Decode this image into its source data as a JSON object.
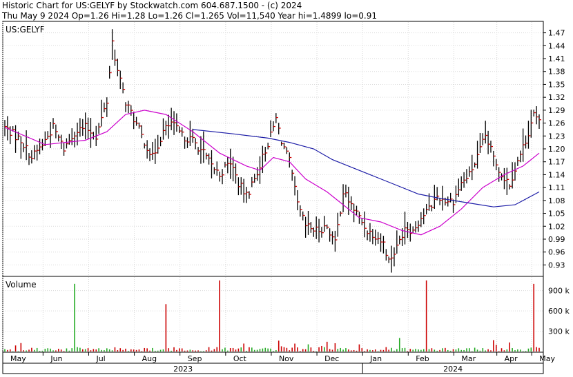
{
  "header": {
    "line1": "Historic Chart for US:GELYF by Stockwatch.com 604.687.1500 - (c) 2024",
    "line2": "Thu May  9 2024  Op=1.26  Hi=1.28  Lo=1.26  Cl=1.265  Vol=11,540  Year hi=1.4899  lo=0.91"
  },
  "colors": {
    "background": "#ffffff",
    "grid": "#d9d9d9",
    "up_bar": "#000000",
    "down_tick": "#cc0000",
    "ma_short": "#cc00cc",
    "ma_long": "#1a1aa6",
    "vol_up": "#22aa22",
    "vol_down": "#cc0000"
  },
  "chart_data": [
    {
      "type": "ohlc",
      "title": "US:GELYF",
      "y_ticks": [
        0.93,
        0.96,
        0.99,
        1.02,
        1.05,
        1.08,
        1.11,
        1.14,
        1.17,
        1.2,
        1.23,
        1.26,
        1.29,
        1.32,
        1.35,
        1.38,
        1.41,
        1.44,
        1.47
      ],
      "y_tick_labels": [
        "0.93",
        "0.96",
        "0.99",
        "1.02",
        "1.05",
        "1.08",
        "1.11",
        "1.14",
        "1.17",
        "1.20",
        "1.23",
        "1.26",
        "1.29",
        "1.32",
        "1.35",
        "1.38",
        "1.41",
        "1.44",
        "1.47"
      ],
      "ylim": [
        0.905,
        1.495
      ],
      "grid": true,
      "x_tick_labels": [
        "May",
        "Jun",
        "Jul",
        "Aug",
        "Sep",
        "Oct",
        "Nov",
        "Dec",
        "Jan",
        "Feb",
        "Mar",
        "Apr",
        "May"
      ],
      "year_labels": [
        "2023",
        "2024"
      ],
      "close_anchors": [
        [
          0,
          1.25
        ],
        [
          6,
          1.22
        ],
        [
          10,
          1.18
        ],
        [
          14,
          1.21
        ],
        [
          18,
          1.25
        ],
        [
          22,
          1.2
        ],
        [
          26,
          1.24
        ],
        [
          30,
          1.25
        ],
        [
          34,
          1.23
        ],
        [
          38,
          1.31
        ],
        [
          40,
          1.45
        ],
        [
          42,
          1.38
        ],
        [
          45,
          1.31
        ],
        [
          48,
          1.27
        ],
        [
          51,
          1.23
        ],
        [
          55,
          1.18
        ],
        [
          59,
          1.24
        ],
        [
          62,
          1.26
        ],
        [
          66,
          1.23
        ],
        [
          70,
          1.22
        ],
        [
          74,
          1.19
        ],
        [
          77,
          1.16
        ],
        [
          80,
          1.14
        ],
        [
          84,
          1.17
        ],
        [
          87,
          1.12
        ],
        [
          90,
          1.09
        ],
        [
          93,
          1.13
        ],
        [
          96,
          1.18
        ],
        [
          99,
          1.23
        ],
        [
          101,
          1.27
        ],
        [
          103,
          1.22
        ],
        [
          106,
          1.17
        ],
        [
          109,
          1.07
        ],
        [
          112,
          1.02
        ],
        [
          116,
          1.01
        ],
        [
          120,
          1.02
        ],
        [
          123,
          0.98
        ],
        [
          126,
          1.1
        ],
        [
          129,
          1.07
        ],
        [
          132,
          1.04
        ],
        [
          135,
          1.01
        ],
        [
          138,
          1.0
        ],
        [
          141,
          0.98
        ],
        [
          143,
          0.94
        ],
        [
          146,
          0.97
        ],
        [
          149,
          1.02
        ],
        [
          152,
          1.01
        ],
        [
          155,
          1.04
        ],
        [
          158,
          1.06
        ],
        [
          161,
          1.09
        ],
        [
          164,
          1.08
        ],
        [
          167,
          1.08
        ],
        [
          170,
          1.12
        ],
        [
          173,
          1.14
        ],
        [
          176,
          1.18
        ],
        [
          179,
          1.23
        ],
        [
          182,
          1.18
        ],
        [
          185,
          1.14
        ],
        [
          188,
          1.12
        ],
        [
          191,
          1.17
        ],
        [
          194,
          1.22
        ],
        [
          197,
          1.28
        ],
        [
          199,
          1.26
        ]
      ],
      "ma_short": [
        [
          0,
          1.25
        ],
        [
          15,
          1.21
        ],
        [
          30,
          1.22
        ],
        [
          38,
          1.24
        ],
        [
          45,
          1.28
        ],
        [
          52,
          1.29
        ],
        [
          60,
          1.28
        ],
        [
          70,
          1.24
        ],
        [
          80,
          1.19
        ],
        [
          90,
          1.16
        ],
        [
          95,
          1.15
        ],
        [
          100,
          1.18
        ],
        [
          106,
          1.17
        ],
        [
          112,
          1.13
        ],
        [
          120,
          1.1
        ],
        [
          126,
          1.07
        ],
        [
          132,
          1.04
        ],
        [
          140,
          1.03
        ],
        [
          148,
          1.01
        ],
        [
          155,
          1.0
        ],
        [
          162,
          1.02
        ],
        [
          170,
          1.06
        ],
        [
          178,
          1.11
        ],
        [
          186,
          1.14
        ],
        [
          193,
          1.16
        ],
        [
          199,
          1.19
        ]
      ],
      "ma_long": [
        [
          70,
          1.245
        ],
        [
          85,
          1.235
        ],
        [
          98,
          1.225
        ],
        [
          106,
          1.215
        ],
        [
          115,
          1.2
        ],
        [
          122,
          1.175
        ],
        [
          130,
          1.155
        ],
        [
          138,
          1.135
        ],
        [
          146,
          1.115
        ],
        [
          154,
          1.095
        ],
        [
          162,
          1.085
        ],
        [
          172,
          1.075
        ],
        [
          182,
          1.065
        ],
        [
          190,
          1.07
        ],
        [
          199,
          1.1
        ]
      ],
      "volume_ticks": [
        300,
        600,
        900
      ],
      "volume_tick_labels": [
        "300 k",
        "600 k",
        "900 k"
      ],
      "volume_label": "Volume",
      "volume_max": 1100,
      "volume_spikes": [
        [
          26,
          1000,
          "up"
        ],
        [
          60,
          700,
          "down"
        ],
        [
          80,
          1050,
          "down"
        ],
        [
          147,
          200,
          "up"
        ],
        [
          157,
          1050,
          "down"
        ],
        [
          197,
          1000,
          "down"
        ]
      ]
    }
  ]
}
